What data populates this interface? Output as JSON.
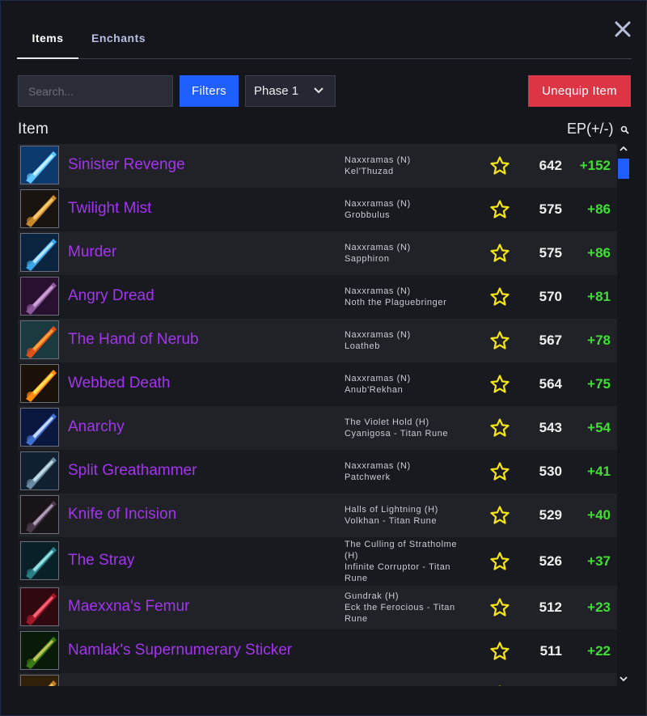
{
  "tabs": [
    {
      "label": "Items",
      "active": true
    },
    {
      "label": "Enchants",
      "active": false
    }
  ],
  "toolbar": {
    "search_placeholder": "Search...",
    "filters_label": "Filters",
    "phase_value": "Phase 1",
    "unequip_label": "Unequip Item"
  },
  "columns": {
    "item": "Item",
    "ep": "EP(+/-)"
  },
  "colors": {
    "accent": "#1f5eff",
    "danger": "#dc3545",
    "epic": "#a335ee",
    "positive": "#3fdf33",
    "star": "#f5e614"
  },
  "items": [
    {
      "name": "Sinister Revenge",
      "source_line1": "Naxxramas (N)",
      "source_line2": "Kel'Thuzad",
      "source_line3": "",
      "source_line4": "",
      "ep": "642",
      "delta": "+152",
      "icon": "dagger-blue-icon"
    },
    {
      "name": "Twilight Mist",
      "source_line1": "Naxxramas (N)",
      "source_line2": "Grobbulus",
      "source_line3": "",
      "source_line4": "",
      "ep": "575",
      "delta": "+86",
      "icon": "staff-gold-icon"
    },
    {
      "name": "Murder",
      "source_line1": "Naxxramas (N)",
      "source_line2": "Sapphiron",
      "source_line3": "",
      "source_line4": "",
      "ep": "575",
      "delta": "+86",
      "icon": "blade-ice-icon"
    },
    {
      "name": "Angry Dread",
      "source_line1": "Naxxramas (N)",
      "source_line2": "Noth the Plaguebringer",
      "source_line3": "",
      "source_line4": "",
      "ep": "570",
      "delta": "+81",
      "icon": "dagger-purple-icon"
    },
    {
      "name": "The Hand of Nerub",
      "source_line1": "Naxxramas (N)",
      "source_line2": "Loatheb",
      "source_line3": "",
      "source_line4": "",
      "ep": "567",
      "delta": "+78",
      "icon": "claw-orange-icon"
    },
    {
      "name": "Webbed Death",
      "source_line1": "Naxxramas (N)",
      "source_line2": "Anub'Rekhan",
      "source_line3": "",
      "source_line4": "",
      "ep": "564",
      "delta": "+75",
      "icon": "blade-fire-icon"
    },
    {
      "name": "Anarchy",
      "source_line1": "The Violet Hold (H)",
      "source_line2": "Cyanigosa - Titan Rune",
      "source_line3": "",
      "source_line4": "",
      "ep": "543",
      "delta": "+54",
      "icon": "sword-blue-icon"
    },
    {
      "name": "Split Greathammer",
      "source_line1": "Naxxramas (N)",
      "source_line2": "Patchwerk",
      "source_line3": "",
      "source_line4": "",
      "ep": "530",
      "delta": "+41",
      "icon": "hammer-frost-icon"
    },
    {
      "name": "Knife of Incision",
      "source_line1": "Halls of Lightning (H)",
      "source_line2": "Volkhan - Titan Rune",
      "source_line3": "",
      "source_line4": "",
      "ep": "529",
      "delta": "+40",
      "icon": "knife-dark-icon"
    },
    {
      "name": "The Stray",
      "source_line1": "The Culling of Stratholme",
      "source_line2": "(H)",
      "source_line3": "Infinite Corruptor - Titan",
      "source_line4": "Rune",
      "ep": "526",
      "delta": "+37",
      "icon": "axe-teal-icon"
    },
    {
      "name": "Maexxna's Femur",
      "source_line1": "Gundrak (H)",
      "source_line2": "Eck the Ferocious - Titan",
      "source_line3": "Rune",
      "source_line4": "",
      "ep": "512",
      "delta": "+23",
      "icon": "mace-red-icon"
    },
    {
      "name": "Namlak's Supernumerary Sticker",
      "source_line1": "",
      "source_line2": "",
      "source_line3": "",
      "source_line4": "",
      "ep": "511",
      "delta": "+22",
      "icon": "spear-green-icon"
    },
    {
      "name": "",
      "source_line1": "",
      "source_line2": "",
      "source_line3": "",
      "source_line4": "",
      "ep": "",
      "delta": "",
      "icon": "partial-item-icon"
    }
  ]
}
